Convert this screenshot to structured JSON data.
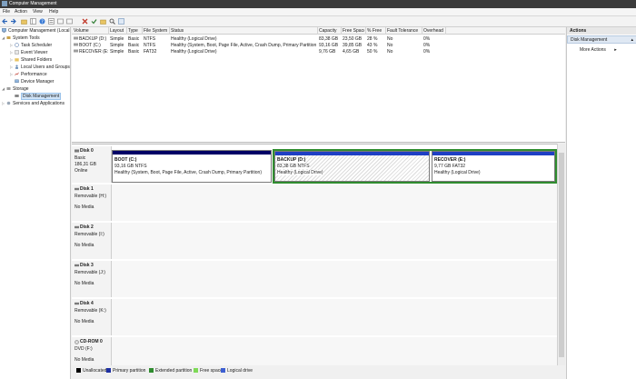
{
  "window": {
    "title": "Computer Management"
  },
  "menu": [
    "File",
    "Action",
    "View",
    "Help"
  ],
  "tree": {
    "root": "Computer Management (Local",
    "items": [
      {
        "label": "System Tools",
        "level": 1,
        "icon": "tools-icon"
      },
      {
        "label": "Task Scheduler",
        "level": 2,
        "icon": "clock-icon"
      },
      {
        "label": "Event Viewer",
        "level": 2,
        "icon": "event-icon"
      },
      {
        "label": "Shared Folders",
        "level": 2,
        "icon": "folder-icon"
      },
      {
        "label": "Local Users and Groups",
        "level": 2,
        "icon": "users-icon"
      },
      {
        "label": "Performance",
        "level": 2,
        "icon": "performance-icon"
      },
      {
        "label": "Device Manager",
        "level": 2,
        "icon": "device-icon"
      },
      {
        "label": "Storage",
        "level": 1,
        "icon": "storage-icon"
      },
      {
        "label": "Disk Management",
        "level": 2,
        "icon": "disk-icon",
        "selected": true
      },
      {
        "label": "Services and Applications",
        "level": 1,
        "icon": "services-icon"
      }
    ]
  },
  "volumes": {
    "headers": [
      "Volume",
      "Layout",
      "Type",
      "File System",
      "Status",
      "Capacity",
      "Free Space",
      "% Free",
      "Fault Tolerance",
      "Overhead"
    ],
    "rows": [
      [
        "BACKUP (D:)",
        "Simple",
        "Basic",
        "NTFS",
        "Healthy (Logical Drive)",
        "83,38 GB",
        "23,50 GB",
        "28 %",
        "No",
        "0%"
      ],
      [
        "BOOT (C:)",
        "Simple",
        "Basic",
        "NTFS",
        "Healthy (System, Boot, Page File, Active, Crash Dump, Primary Partition)",
        "93,16 GB",
        "39,85 GB",
        "43 %",
        "No",
        "0%"
      ],
      [
        "RECOVER (E:)",
        "Simple",
        "Basic",
        "FAT32",
        "Healthy (Logical Drive)",
        "9,76 GB",
        "4,65 GB",
        "50 %",
        "No",
        "0%"
      ]
    ]
  },
  "disks": [
    {
      "name": "Disk 0",
      "line2": "Basic",
      "line3": "186,31 GB",
      "line4": "Online",
      "partitions": [
        {
          "name": "BOOT (C:)",
          "size": "93,16 GB NTFS",
          "status": "Healthy (System, Boot, Page File, Active, Crash Dump, Primary Partition)",
          "kind": "primary"
        },
        {
          "name": "BACKUP (D:)",
          "size": "83,38 GB NTFS",
          "status": "Healthy (Logical Drive)",
          "kind": "logical-selected"
        },
        {
          "name": "RECOVER (E:)",
          "size": "9,77 GB FAT32",
          "status": "Healthy (Logical Drive)",
          "kind": "logical"
        }
      ]
    },
    {
      "name": "Disk 1",
      "line2": "Removable (H:)",
      "line3": "",
      "line4": "No Media",
      "partitions": []
    },
    {
      "name": "Disk 2",
      "line2": "Removable (I:)",
      "line3": "",
      "line4": "No Media",
      "partitions": []
    },
    {
      "name": "Disk 3",
      "line2": "Removable (J:)",
      "line3": "",
      "line4": "No Media",
      "partitions": []
    },
    {
      "name": "Disk 4",
      "line2": "Removable (K:)",
      "line3": "",
      "line4": "No Media",
      "partitions": []
    },
    {
      "name": "CD-ROM 0",
      "line2": "DVD (F:)",
      "line3": "",
      "line4": "No Media",
      "partitions": []
    }
  ],
  "legend": [
    {
      "label": "Unallocated",
      "color": "#000000"
    },
    {
      "label": "Primary partition",
      "color": "#1d2fa3"
    },
    {
      "label": "Extended partition",
      "color": "#2f8c2f"
    },
    {
      "label": "Free space",
      "color": "#7ed957"
    },
    {
      "label": "Logical drive",
      "color": "#3d5fd1"
    }
  ],
  "actions": {
    "title": "Actions",
    "section": "Disk Management",
    "more": "More Actions"
  },
  "colors": {
    "primary_band": "#000066",
    "logical_band": "#1f3fc4",
    "extended_border": "#2f8c2f",
    "selection": "#cfe3f7"
  }
}
